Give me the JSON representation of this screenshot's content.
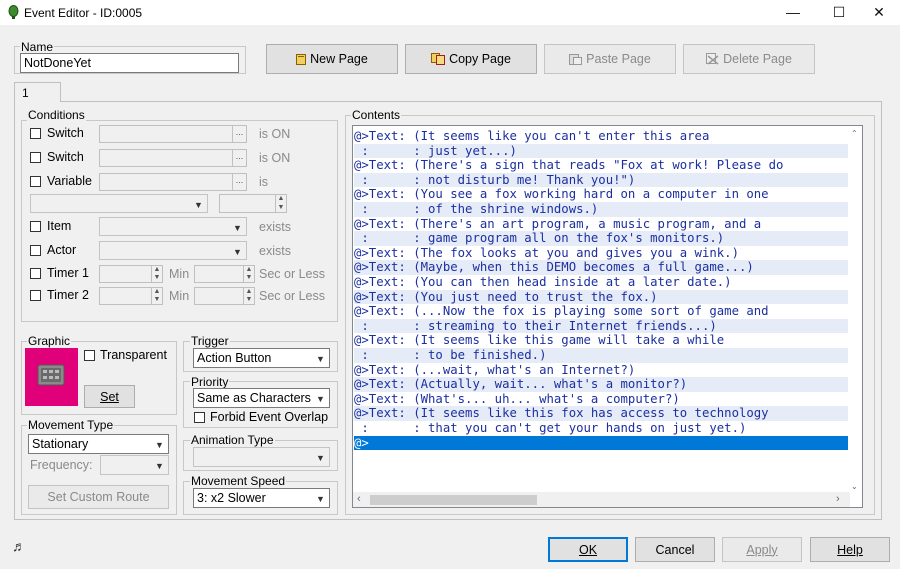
{
  "window": {
    "title": "Event Editor - ID:0005",
    "minimize": "—",
    "maximize": "☐",
    "close": "✕"
  },
  "name": {
    "label": "Name",
    "value": "NotDoneYet"
  },
  "toolbar": {
    "new_page": "New Page",
    "copy_page": "Copy Page",
    "paste_page": "Paste Page",
    "delete_page": "Delete Page"
  },
  "page_tab": "1",
  "conditions": {
    "label": "Conditions",
    "switch1": {
      "label": "Switch",
      "suffix": "is ON"
    },
    "switch2": {
      "label": "Switch",
      "suffix": "is ON"
    },
    "variable": {
      "label": "Variable",
      "suffix": "is"
    },
    "item": {
      "label": "Item",
      "suffix": "exists"
    },
    "actor": {
      "label": "Actor",
      "suffix": "exists"
    },
    "timer1": {
      "label": "Timer 1",
      "min": "Min",
      "sec": "Sec or Less"
    },
    "timer2": {
      "label": "Timer 2",
      "min": "Min",
      "sec": "Sec or Less"
    },
    "ellipsis": "...",
    "spin_up": "▲",
    "spin_down": "▼",
    "dd_arrow": "▼"
  },
  "graphic": {
    "label": "Graphic",
    "transparent": "Transparent",
    "set": "Set",
    "bg_color": "#e0007a"
  },
  "trigger": {
    "label": "Trigger",
    "value": "Action Button"
  },
  "priority": {
    "label": "Priority",
    "value": "Same as Characters",
    "forbid": "Forbid Event Overlap"
  },
  "movement_type": {
    "label": "Movement Type",
    "value": "Stationary",
    "frequency": "Frequency:",
    "custom_route": "Set Custom Route"
  },
  "animation_type": {
    "label": "Animation Type",
    "value": ""
  },
  "movement_speed": {
    "label": "Movement Speed",
    "value": "3: x2 Slower"
  },
  "contents": {
    "label": "Contents",
    "lines": [
      "@>Text: (It seems like you can't enter this area",
      " :      : just yet...)",
      "@>Text: (There's a sign that reads \"Fox at work! Please do",
      " :      : not disturb me! Thank you!\")",
      "@>Text: (You see a fox working hard on a computer in one",
      " :      : of the shrine windows.)",
      "@>Text: (There's an art program, a music program, and a",
      " :      : game program all on the fox's monitors.)",
      "@>Text: (The fox looks at you and gives you a wink.)",
      "@>Text: (Maybe, when this DEMO becomes a full game...)",
      "@>Text: (You can then head inside at a later date.)",
      "@>Text: (You just need to trust the fox.)",
      "@>Text: (...Now the fox is playing some sort of game and",
      " :      : streaming to their Internet friends...)",
      "@>Text: (It seems like this game will take a while",
      " :      : to be finished.)",
      "@>Text: (...wait, what's an Internet?)",
      "@>Text: (Actually, wait... what's a monitor?)",
      "@>Text: (What's... uh... what's a computer?)",
      "@>Text: (It seems like this fox has access to technology",
      " :      : that you can't get your hands on just yet.)",
      "@>"
    ]
  },
  "footer": {
    "ok": "OK",
    "cancel": "Cancel",
    "apply": "Apply",
    "help": "Help",
    "music_icon": "♬"
  },
  "colors": {
    "accent": "#0078d7",
    "text_blue": "#1c2fa0",
    "row_alt": "#e6ecf7"
  }
}
